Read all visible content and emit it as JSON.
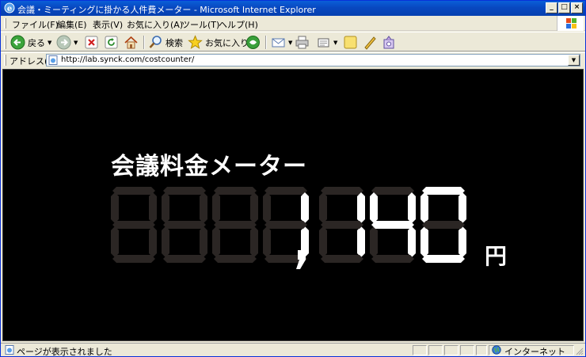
{
  "window": {
    "title": "会議・ミーティングに掛かる人件費メーター - Microsoft Internet Explorer",
    "controls": {
      "minimize": "_",
      "maximize": "□",
      "close": "×"
    }
  },
  "menu": [
    "ファイル(F)",
    "編集(E)",
    "表示(V)",
    "お気に入り(A)",
    "ツール(T)",
    "ヘルプ(H)"
  ],
  "toolbar": {
    "back_label": "戻る",
    "search_label": "検索",
    "favorites_label": "お気に入り"
  },
  "address": {
    "label": "アドレス(D)",
    "url": "http://lab.synck.com/costcounter/"
  },
  "meter": {
    "title": "会議料金メーター",
    "digits": [
      "",
      "",
      "",
      "1",
      "1",
      "4",
      "0"
    ],
    "display": "1,140",
    "unit": "円",
    "colors": {
      "lit": "#ffffff",
      "unlit": "#2b2624",
      "background": "#000000"
    }
  },
  "status": {
    "text": "ページが表示されました",
    "zone": "インターネット"
  }
}
